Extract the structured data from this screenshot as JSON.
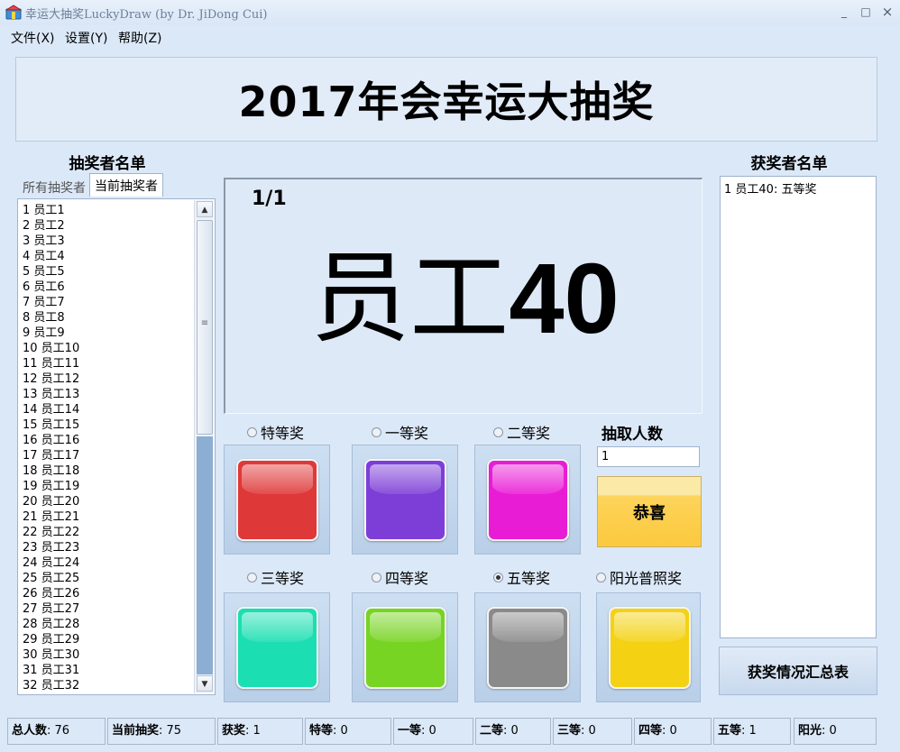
{
  "window": {
    "title": "幸运大抽奖LuckyDraw (by Dr. JiDong Cui)",
    "minimize": "_",
    "maximize": "□",
    "close": "×"
  },
  "menu": {
    "file": "文件(X)",
    "settings": "设置(Y)",
    "help": "帮助(Z)"
  },
  "banner": {
    "title": "2017年会幸运大抽奖"
  },
  "left_panel": {
    "title": "抽奖者名单",
    "tabs": [
      {
        "label": "所有抽奖者",
        "active": false
      },
      {
        "label": "当前抽奖者",
        "active": true
      }
    ],
    "items": [
      "1  员工1",
      "2  员工2",
      "3  员工3",
      "4  员工4",
      "5  员工5",
      "6  员工6",
      "7  员工7",
      "8  员工8",
      "9  员工9",
      "10  员工10",
      "11  员工11",
      "12  员工12",
      "13  员工13",
      "14  员工14",
      "15  员工15",
      "16  员工16",
      "17  员工17",
      "18  员工18",
      "19  员工19",
      "20  员工20",
      "21  员工21",
      "22  员工22",
      "23  员工23",
      "24  员工24",
      "25  员工25",
      "26  员工26",
      "27  员工27",
      "28  员工28",
      "29  员工29",
      "30  员工30",
      "31  员工31",
      "32  员工32"
    ],
    "scroll_up": "▲",
    "scroll_down": "▼",
    "thumb_grip": "≡"
  },
  "display": {
    "counter": "1/1",
    "winner_prefix": "员工",
    "winner_number": "40"
  },
  "prizes": [
    {
      "label": "特等奖",
      "checked": false,
      "color": "#d93a3a"
    },
    {
      "label": "一等奖",
      "checked": false,
      "color": "#7b3fd1"
    },
    {
      "label": "二等奖",
      "checked": false,
      "color": "#e21fd0"
    },
    {
      "label": "三等奖",
      "checked": false,
      "color": "#22dcb2"
    },
    {
      "label": "四等奖",
      "checked": false,
      "color": "#7ad22a"
    },
    {
      "label": "五等奖",
      "checked": true,
      "color": "#8a8a8a"
    },
    {
      "label": "阳光普照奖",
      "checked": false,
      "color": "#f2d21c"
    }
  ],
  "draw": {
    "count_label": "抽取人数",
    "count_value": "1",
    "congrats_label": "恭喜"
  },
  "right_panel": {
    "title": "获奖者名单",
    "winners": [
      "1 员工40: 五等奖"
    ],
    "summary_button": "获奖情况汇总表"
  },
  "status": [
    {
      "label": "总人数",
      "value": ": 76"
    },
    {
      "label": "当前抽奖",
      "value": ": 75"
    },
    {
      "label": "获奖",
      "value": ": 1"
    },
    {
      "label": "特等",
      "value": ": 0"
    },
    {
      "label": "一等",
      "value": ": 0"
    },
    {
      "label": "二等",
      "value": ": 0"
    },
    {
      "label": "三等",
      "value": ": 0"
    },
    {
      "label": "四等",
      "value": ": 0"
    },
    {
      "label": "五等",
      "value": ": 1"
    },
    {
      "label": "阳光",
      "value": ": 0"
    }
  ]
}
